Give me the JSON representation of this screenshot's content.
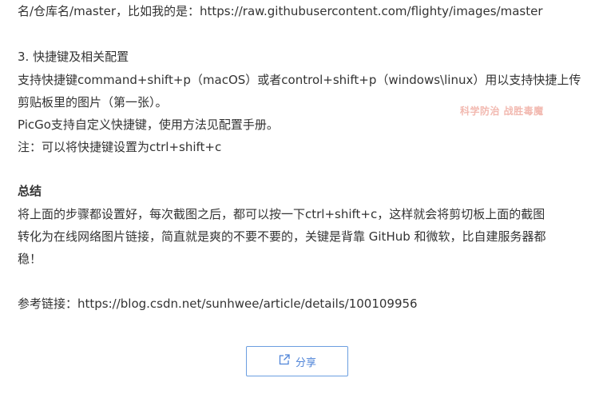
{
  "article": {
    "lines": [
      "名/仓库名/master，比如我的是：https://raw.githubusercontent.com/flighty/images/master",
      "3. 快捷键及相关配置",
      "支持快捷键command+shift+p（macOS）或者control+shift+p（windows\\linux）用以支持快捷上传",
      "剪贴板里的图片（第一张）。",
      "PicGo支持自定义快捷键，使用方法见配置手册。",
      "注：可以将快捷键设置为ctrl+shift+c",
      "总结",
      "将上面的步骤都设置好，每次截图之后，都可以按一下ctrl+shift+c，这样就会将剪切板上面的截图",
      "转化为在线网络图片链接，简直就是爽的不要不要的，关键是背靠 GitHub 和微软，比自建服务器都",
      "稳！",
      "参考链接：https://blog.csdn.net/sunhwee/article/details/100109956"
    ]
  },
  "watermark": "科学防治 战胜毒魔",
  "share": {
    "label": "分享",
    "icon": "share-icon"
  }
}
